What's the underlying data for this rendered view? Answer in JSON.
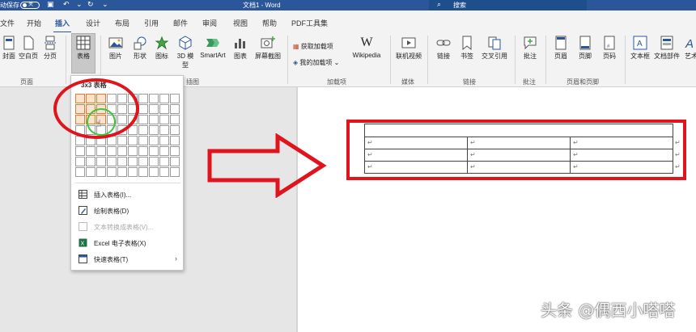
{
  "titlebar": {
    "autosave": "动保存",
    "autosave_toggle": "关",
    "doc_title": "文档1 - Word",
    "search": "搜索"
  },
  "tabs": [
    "文件",
    "开始",
    "插入",
    "设计",
    "布局",
    "引用",
    "邮件",
    "审阅",
    "视图",
    "帮助",
    "PDF工具集"
  ],
  "active_tab": "插入",
  "ribbon": {
    "pages": [
      "封面",
      "空白页",
      "分页"
    ],
    "pages_group": "页面",
    "table": "表格",
    "illustrations": [
      "图片",
      "形状",
      "图标",
      "3D 模型",
      "SmartArt",
      "图表",
      "屏幕截图"
    ],
    "illustrations_group": "插图",
    "addins": [
      "获取加载项",
      "我的加载项"
    ],
    "wikipedia": "Wikipedia",
    "addins_group": "加载项",
    "online_video": "联机视频",
    "media_group": "媒体",
    "links": [
      "链接",
      "书签",
      "交叉引用"
    ],
    "links_group": "链接",
    "comment": "批注",
    "comment_group": "批注",
    "header_footer": [
      "页眉",
      "页脚",
      "页码"
    ],
    "header_footer_group": "页眉和页脚",
    "text": [
      "文本框",
      "文档部件",
      "艺术"
    ]
  },
  "dropdown": {
    "title": "3x3 表格",
    "grid_cols": 10,
    "grid_rows": 8,
    "selected_cols": 3,
    "selected_rows": 3,
    "items": [
      {
        "label": "插入表格(I)...",
        "disabled": false
      },
      {
        "label": "绘制表格(D)",
        "disabled": false
      },
      {
        "label": "文本转换成表格(V)...",
        "disabled": true
      },
      {
        "label": "Excel 电子表格(X)",
        "disabled": false
      },
      {
        "label": "快速表格(T)",
        "disabled": false,
        "submenu": true
      }
    ]
  },
  "document": {
    "paragraph_mark": "↵"
  },
  "watermark": "头条 @偶西小嗒嗒",
  "colors": {
    "title_bar": "#2b579a",
    "annotation_red": "#e0141c",
    "annotation_green": "#3cc43c",
    "selected_cell": "#e07a2c"
  }
}
